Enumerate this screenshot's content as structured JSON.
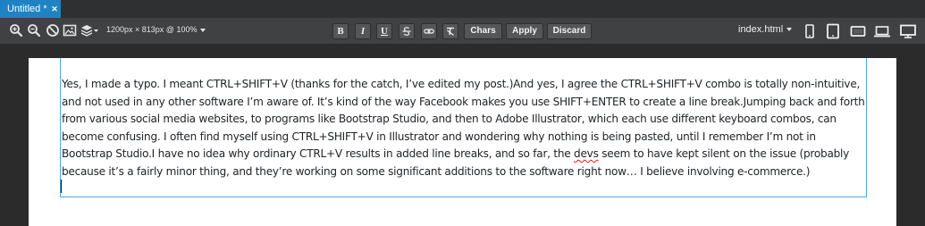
{
  "tab": {
    "title": "Untitled *",
    "close_symbol": "✕"
  },
  "toolbar": {
    "left_icons": [
      "zoom-in-icon",
      "zoom-out-icon",
      "disable-icon",
      "image-icon",
      "layers-icon"
    ],
    "canvas_size": "1200px × 813px @ 100%",
    "format_buttons": [
      {
        "name": "bold",
        "label": "B"
      },
      {
        "name": "italic",
        "label": "I"
      },
      {
        "name": "underline",
        "label": "U"
      },
      {
        "name": "strikethrough",
        "icon": "strikethrough-icon"
      },
      {
        "name": "link",
        "icon": "link-icon"
      },
      {
        "name": "clear-format",
        "icon": "clear-format-icon"
      }
    ],
    "chars_label": "Chars",
    "apply_label": "Apply",
    "discard_label": "Discard",
    "page_select": "index.html",
    "device_icons": [
      "phone-icon",
      "tablet-icon",
      "tablet-landscape-icon",
      "laptop-icon",
      "desktop-icon"
    ]
  },
  "editor": {
    "paragraph_before": "Yes, I made a typo. I meant CTRL+SHIFT+V (thanks for the catch, I’ve edited my post.)And yes, I agree the CTRL+SHIFT+V combo is totally non-intuitive, and not used in any other software I’m aware of. It’s kind of the way Facebook makes you use SHIFT+ENTER to create a line break.Jumping back and forth from various social media websites, to programs like Bootstrap Studio, and then to Adobe Illustrator, which each use different keyboard combos, can become confusing. I often find myself using CTRL+SHIFT+V in Illustrator and wondering why nothing is being pasted, until I remember I’m not in Bootstrap Studio.I have no idea why ordinary CTRL+V results in added line breaks, and so far, the ",
    "misspelled_word": "devs",
    "paragraph_after": " seem to have kept silent on the issue (probably because it’s a fairly minor thing, and they’re working on some significant additions to the software right now… I believe involving e-commerce.)"
  },
  "colors": {
    "tab_active": "#1f83c3",
    "toolbar_bg": "#3f4142",
    "button_bg": "#545657",
    "selection_outline": "#4aa8e8",
    "workspace_bg": "#2b2b2b"
  }
}
